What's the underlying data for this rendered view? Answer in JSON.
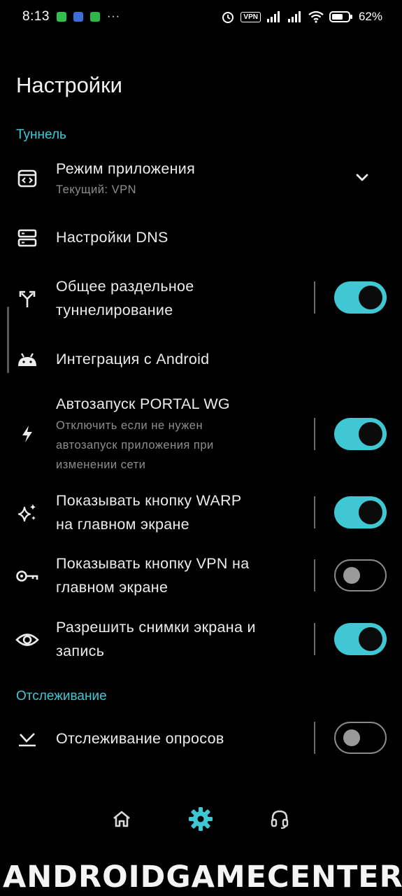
{
  "status_bar": {
    "time": "8:13",
    "dots": "···",
    "vpn": "VPN",
    "battery": "62%"
  },
  "page": {
    "title": "Настройки"
  },
  "sections": {
    "tunnel": "Туннель",
    "tracking": "Отслеживание"
  },
  "settings": {
    "app_mode": {
      "title": "Режим приложения",
      "subtitle": "Текущий: VPN"
    },
    "dns": {
      "title": "Настройки DNS"
    },
    "split_tunnel": {
      "title_line1": "Общее раздельное",
      "title_line2": "туннелирование",
      "enabled": true
    },
    "android": {
      "title": "Интеграция с Android"
    },
    "autostart": {
      "title": "Автозапуск PORTAL WG",
      "sub_line1": "Отключить если не нужен",
      "sub_line2": "автозапуск приложения при",
      "sub_line3": "изменении сети",
      "enabled": true
    },
    "warp_button": {
      "title_line1": "Показывать кнопку WARP",
      "title_line2": "на главном экране",
      "enabled": true
    },
    "vpn_button": {
      "title_line1": "Показывать кнопку VPN на",
      "title_line2": "главном экране",
      "enabled": false
    },
    "screenshots": {
      "title_line1": "Разрешить снимки экрана и",
      "title_line2": "запись",
      "enabled": true
    },
    "poll_tracking": {
      "title": "Отслеживание опросов",
      "enabled": false
    }
  },
  "icons": {
    "app_mode": "app-window-code-icon",
    "dns": "dns-server-icon",
    "split_tunnel": "split-arrows-icon",
    "android": "android-icon",
    "autostart": "bolt-icon",
    "warp": "sparkles-icon",
    "vpn": "key-icon",
    "screenshots": "eye-icon",
    "poll": "poll-check-icon"
  },
  "bottom_nav": [
    "home",
    "settings",
    "support"
  ],
  "watermark": "ANDROIDGAMECENTER.LA",
  "colors": {
    "accent": "#3fc8d4",
    "background": "#000000"
  }
}
